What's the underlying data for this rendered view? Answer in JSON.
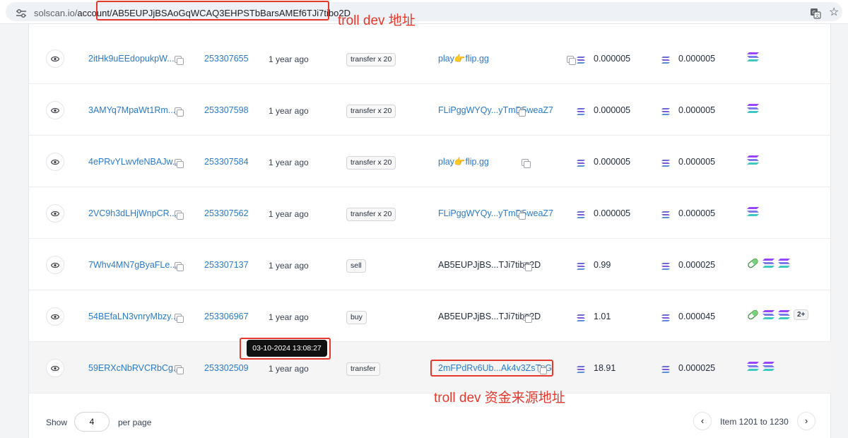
{
  "browser": {
    "url_host": "solscan.io/",
    "url_path": "account/AB5EUPJjBSAoGqWCAQ3EHPSTbBarsAMEf6TJi7tibo2D"
  },
  "annotations": {
    "dev_label": "troll dev 地址",
    "source_label": "troll dev 资金来源地址",
    "color": "#e5372b"
  },
  "rows": [
    {
      "sig": "2itHk9uEEdopukpW...",
      "block": "253307655",
      "age": "1 year ago",
      "type": "transfer x 20",
      "by": "play👉flip.gg",
      "by_link": true,
      "value": "0.000005",
      "fee": "0.000005",
      "tokens": [
        "sol"
      ]
    },
    {
      "sig": "3AMYq7MpaWt1Rm...",
      "block": "253307598",
      "age": "1 year ago",
      "type": "transfer x 20",
      "by": "FLiPggWYQy...yTmD5weaZ7",
      "by_link": true,
      "value": "0.000005",
      "fee": "0.000005",
      "tokens": [
        "sol"
      ]
    },
    {
      "sig": "4ePRvYLwvfeNBAJw...",
      "block": "253307584",
      "age": "1 year ago",
      "type": "transfer x 20",
      "by": "play👉flip.gg",
      "by_link": true,
      "value": "0.000005",
      "fee": "0.000005",
      "tokens": [
        "sol"
      ]
    },
    {
      "sig": "2VC9h3dLHjWnpCR...",
      "block": "253307562",
      "age": "1 year ago",
      "type": "transfer x 20",
      "by": "FLiPggWYQy...yTmD5weaZ7",
      "by_link": true,
      "value": "0.000005",
      "fee": "0.000005",
      "tokens": [
        "sol"
      ]
    },
    {
      "sig": "7Whv4MN7gByaFLe...",
      "block": "253307137",
      "age": "1 year ago",
      "type": "sell",
      "by": "AB5EUPJjBS...TJi7tibo2D",
      "by_link": false,
      "value": "0.99",
      "fee": "0.000025",
      "tokens": [
        "pill",
        "sol",
        "sol"
      ]
    },
    {
      "sig": "54BEfaLN3vnryMbzy...",
      "block": "253306967",
      "age": "1 year ago",
      "type": "buy",
      "by": "AB5EUPJjBS...TJi7tibo2D",
      "by_link": false,
      "value": "1.01",
      "fee": "0.000045",
      "tokens": [
        "pill",
        "sol",
        "sol"
      ],
      "more": "2+"
    },
    {
      "sig": "59ERXcNbRVCRbCg...",
      "block": "253302509",
      "age": "1 year ago",
      "type": "transfer",
      "by": "2mFPdRv6Ub...Ak4v3ZsTvG",
      "by_link": true,
      "value": "18.91",
      "fee": "0.000025",
      "tokens": [
        "sol",
        "sol"
      ]
    }
  ],
  "tooltip": "03-10-2024 13:08:27",
  "footer": {
    "show_label": "Show",
    "page_size": "4",
    "per_page_label": "per page",
    "item_range": "Item 1201 to 1230",
    "prev_icon": "chevron-left-icon",
    "next_icon": "chevron-right-icon"
  }
}
